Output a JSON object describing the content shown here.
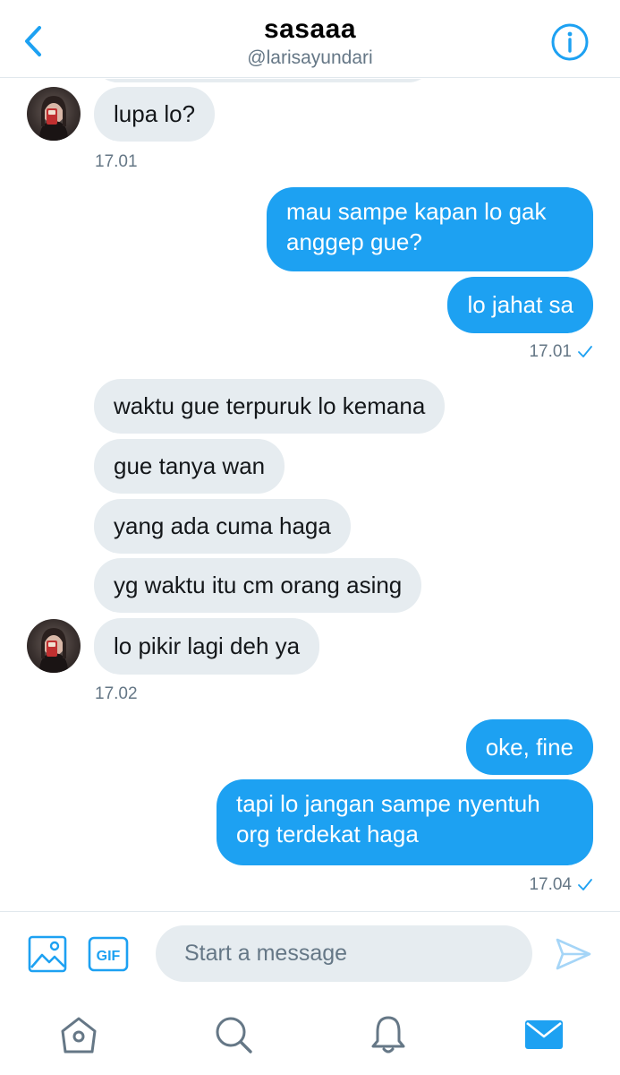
{
  "header": {
    "title": "sasaaa",
    "handle": "@larisayundari",
    "icons": {
      "back": "chevron-left-icon",
      "info": "info-icon"
    }
  },
  "messages": [
    {
      "side": "in",
      "text": "lupa lo?"
    },
    {
      "side": "timestamp-in",
      "text": "17.01"
    },
    {
      "side": "out",
      "text": "mau sampe kapan lo gak anggep gue?"
    },
    {
      "side": "out",
      "text": "lo jahat sa"
    },
    {
      "side": "timestamp-out",
      "text": "17.01",
      "read": true
    },
    {
      "side": "in",
      "text": "waktu gue terpuruk lo kemana"
    },
    {
      "side": "in",
      "text": "gue tanya wan"
    },
    {
      "side": "in",
      "text": "yang ada cuma haga"
    },
    {
      "side": "in",
      "text": "yg waktu itu cm orang asing"
    },
    {
      "side": "in",
      "text": "lo pikir lagi deh ya"
    },
    {
      "side": "timestamp-in",
      "text": "17.02"
    },
    {
      "side": "out",
      "text": "oke, fine"
    },
    {
      "side": "out",
      "text": "tapi lo jangan sampe nyentuh org terdekat haga"
    },
    {
      "side": "timestamp-out",
      "text": "17.04",
      "read": true
    }
  ],
  "composer": {
    "placeholder": "Start a message",
    "value": "",
    "gif_label": "GIF",
    "icons": {
      "media": "image-icon",
      "gif": "gif-icon",
      "send": "send-icon"
    }
  },
  "tabbar": {
    "tabs": [
      {
        "icon": "home-icon",
        "active": false
      },
      {
        "icon": "search-icon",
        "active": false
      },
      {
        "icon": "notifications-bell-icon",
        "active": false
      },
      {
        "icon": "messages-envelope-icon",
        "active": true
      }
    ]
  },
  "colors": {
    "accent": "#1da1f2",
    "incoming_bubble": "#e6ecf0",
    "secondary_text": "#657786",
    "inactive_icon": "#657786"
  }
}
